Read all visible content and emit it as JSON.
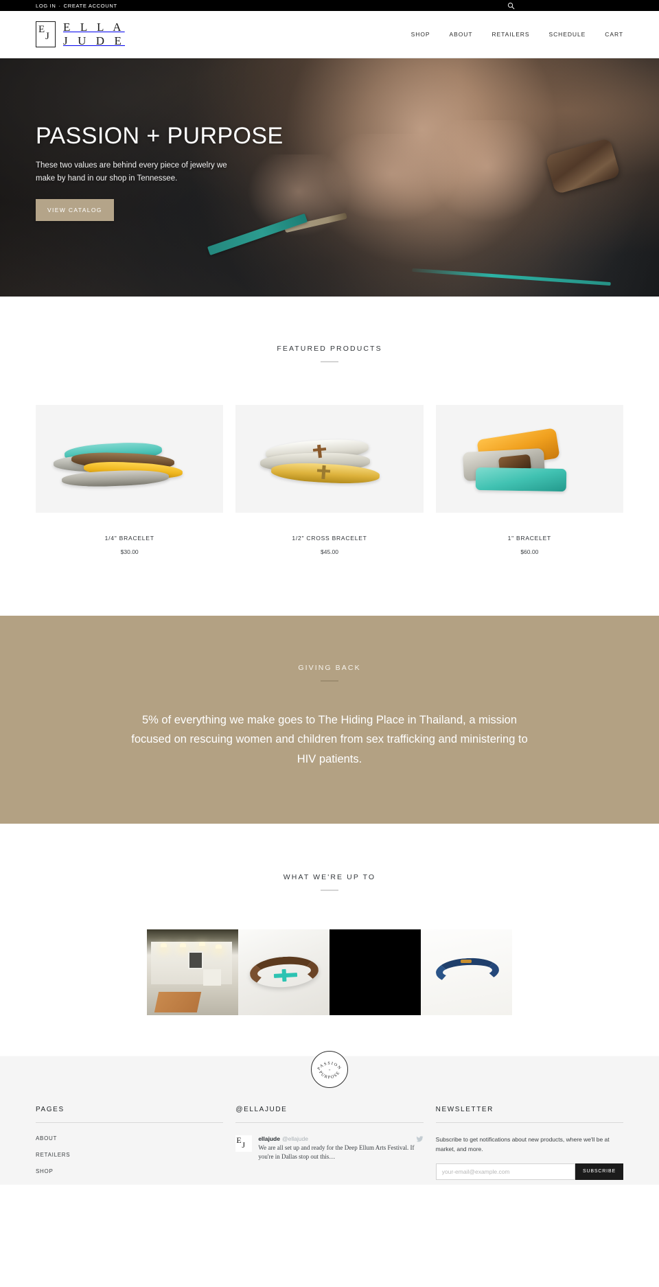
{
  "topbar": {
    "login": "LOG IN",
    "separator": "·",
    "create_account": "CREATE ACCOUNT",
    "search_icon": "search-icon"
  },
  "header": {
    "logo_mark_e": "E",
    "logo_mark_j": "J",
    "logo_line1": "E L L A",
    "logo_line2": "J U D E",
    "nav": [
      {
        "label": "SHOP"
      },
      {
        "label": "ABOUT"
      },
      {
        "label": "RETAILERS"
      },
      {
        "label": "SCHEDULE"
      },
      {
        "label": "CART"
      }
    ]
  },
  "hero": {
    "title": "PASSION + PURPOSE",
    "subtitle": "These two values are behind every piece of jewelry we make by hand in our shop in Tennessee.",
    "button_label": "VIEW CATALOG",
    "button_color": "#b4a489"
  },
  "featured": {
    "title": "FEATURED PRODUCTS",
    "products": [
      {
        "name": "1/4\" BRACELET",
        "price": "$30.00"
      },
      {
        "name": "1/2\" CROSS BRACELET",
        "price": "$45.00"
      },
      {
        "name": "1\" BRACELET",
        "price": "$60.00"
      }
    ]
  },
  "giving": {
    "title": "GIVING BACK",
    "body": "5% of everything we make goes to The Hiding Place in Thailand, a mission focused on rescuing women and children from sex trafficking and ministering to HIV patients.",
    "background_color": "#b3a183"
  },
  "upto": {
    "title": "WHAT WE'RE UP TO"
  },
  "badge": {
    "top_text": "PASSION",
    "middle_text": "+",
    "bottom_text": "PURPOSE"
  },
  "footer": {
    "pages": {
      "title": "PAGES",
      "links": [
        {
          "label": "ABOUT"
        },
        {
          "label": "RETAILERS"
        },
        {
          "label": "SHOP"
        }
      ]
    },
    "social": {
      "title": "@ELLAJUDE",
      "tweet": {
        "user": "ellajude",
        "handle": "@ellajude",
        "text": "We are all set up and ready for the Deep Ellum Arts Festival. If you're in Dallas stop out this…",
        "icon": "twitter-bird-icon"
      }
    },
    "newsletter": {
      "title": "NEWSLETTER",
      "description": "Subscribe to get notifications about new products, where we'll be at market, and more.",
      "input_placeholder": "your-email@example.com",
      "input_value": "",
      "button_label": "SUBSCRIBE"
    }
  }
}
